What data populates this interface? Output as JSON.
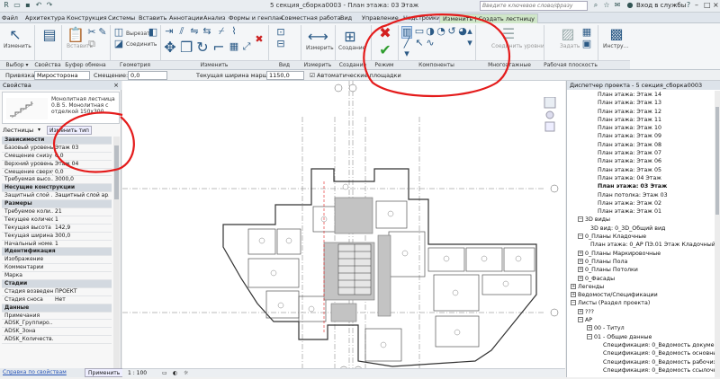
{
  "titlebar": {
    "title": "5 секция_сборка0003 - План этажа: 03 Этаж",
    "search_placeholder": "Введите ключевое слово/фразу",
    "login": "Вход в службы",
    "help": "?"
  },
  "tabs": [
    {
      "label": "Файл",
      "active": false
    },
    {
      "label": "Архитектура",
      "active": false
    },
    {
      "label": "Конструкция",
      "active": false
    },
    {
      "label": "Системы",
      "active": false
    },
    {
      "label": "Вставить",
      "active": false
    },
    {
      "label": "Аннотации",
      "active": false
    },
    {
      "label": "Анализ",
      "active": false
    },
    {
      "label": "Формы и генплан",
      "active": false
    },
    {
      "label": "Совместная работа",
      "active": false
    },
    {
      "label": "Вид",
      "active": false
    },
    {
      "label": "Управление",
      "active": false
    },
    {
      "label": "Надстройки",
      "active": false
    },
    {
      "label": "Изменить | Создать лестницу",
      "active": true
    }
  ],
  "ribbon": {
    "modify_label": "Изменить",
    "insert_label": "Вставить",
    "cut_label": "Вырезать",
    "join_label": "Соединить",
    "measure_label": "Измерить",
    "create_label": "Создание",
    "multilevel_label": "Соединить уровни",
    "set_label": "Задать",
    "tools_label": "Инстру...",
    "panels": [
      "Выбор ▾",
      "Свойства",
      "Буфер обмена",
      "Геометрия",
      "Изменить",
      "Вид",
      "Измерить",
      "Создание",
      "Режим",
      "Компоненты",
      "Многоэтажные лестницы",
      "Рабочая плоскость",
      ""
    ]
  },
  "options": {
    "binding_label": "Привязка:",
    "binding_value": "Миросторона",
    "offset_label": "Смещение:",
    "offset_value": "0,0",
    "width_label": "Текущая ширина марша:",
    "width_value": "1150,0",
    "auto_platform": "Автоматические площадки"
  },
  "properties": {
    "header": "Свойства",
    "type_name": "Монолитная лестница 0.В 5. Монолитная с отделкой 150х300",
    "selector_label": "Лестницы",
    "edit_type": "Изменить тип",
    "rows": [
      {
        "group": true,
        "key": "Зависимости"
      },
      {
        "key": "Базовый уровень",
        "value": "Этаж 03"
      },
      {
        "key": "Смещение снизу",
        "value": "0,0"
      },
      {
        "key": "Верхний уровень",
        "value": "Этаж 04"
      },
      {
        "key": "Смещение сверху",
        "value": "0,0"
      },
      {
        "key": "Требуемая высо...",
        "value": "3000,0"
      },
      {
        "group": true,
        "key": "Несущие конструкции"
      },
      {
        "key": "Защитный слой ...",
        "value": "Защитный слой ар..."
      },
      {
        "group": true,
        "key": "Размеры"
      },
      {
        "key": "Требуемое коли...",
        "value": "21"
      },
      {
        "key": "Текущее количес...",
        "value": "1"
      },
      {
        "key": "Текущая высота ...",
        "value": "142,9"
      },
      {
        "key": "Текущая ширина ...",
        "value": "300,0"
      },
      {
        "key": "Начальный номе...",
        "value": "1"
      },
      {
        "group": true,
        "key": "Идентификация"
      },
      {
        "key": "Изображение",
        "value": ""
      },
      {
        "key": "Комментарии",
        "value": ""
      },
      {
        "key": "Марка",
        "value": ""
      },
      {
        "group": true,
        "key": "Стадии"
      },
      {
        "key": "Стадия возведен...",
        "value": "ПРОЕКТ"
      },
      {
        "key": "Стадия сноса",
        "value": "Нет"
      },
      {
        "group": true,
        "key": "Данные"
      },
      {
        "key": "Примечания",
        "value": ""
      },
      {
        "key": "ADSK_Группиро...",
        "value": ""
      },
      {
        "key": "ADSK_Зона",
        "value": ""
      },
      {
        "key": "ADSK_Количеств...",
        "value": ""
      }
    ],
    "help_link": "Справка по свойствам",
    "apply": "Применить"
  },
  "browser": {
    "header": "Диспетчер проекта - 5 секция_сборка0003",
    "nodes": [
      {
        "indent": 34,
        "label": "План этажа: Этаж 14",
        "exp": "",
        "bold": false
      },
      {
        "indent": 34,
        "label": "План этажа: Этаж 13",
        "exp": "",
        "bold": false
      },
      {
        "indent": 34,
        "label": "План этажа: Этаж 12",
        "exp": "",
        "bold": false
      },
      {
        "indent": 34,
        "label": "План этажа: Этаж 11",
        "exp": "",
        "bold": false
      },
      {
        "indent": 34,
        "label": "План этажа: Этаж 10",
        "exp": "",
        "bold": false
      },
      {
        "indent": 34,
        "label": "План этажа: Этаж 09",
        "exp": "",
        "bold": false
      },
      {
        "indent": 34,
        "label": "План этажа: Этаж 08",
        "exp": "",
        "bold": false
      },
      {
        "indent": 34,
        "label": "План этажа: Этаж 07",
        "exp": "",
        "bold": false
      },
      {
        "indent": 34,
        "label": "План этажа: Этаж 06",
        "exp": "",
        "bold": false
      },
      {
        "indent": 34,
        "label": "План этажа: Этаж 05",
        "exp": "",
        "bold": false
      },
      {
        "indent": 34,
        "label": "План этажа: 04 Этаж",
        "exp": "",
        "bold": false
      },
      {
        "indent": 34,
        "label": "План этажа: 03 Этаж",
        "exp": "",
        "bold": true
      },
      {
        "indent": 34,
        "label": "План потолка: Этаж 03",
        "exp": "",
        "bold": false
      },
      {
        "indent": 34,
        "label": "План этажа: Этаж 02",
        "exp": "",
        "bold": false
      },
      {
        "indent": 34,
        "label": "План этажа: Этаж 01",
        "exp": "",
        "bold": false
      },
      {
        "indent": 12,
        "label": "3D виды",
        "exp": "−",
        "bold": false
      },
      {
        "indent": 26,
        "label": "3D вид: 0_3D_Общий вид",
        "exp": "",
        "bold": false
      },
      {
        "indent": 12,
        "label": "0_Планы Кладочные",
        "exp": "−",
        "bold": false
      },
      {
        "indent": 26,
        "label": "План этажа: 0_АР ПЭ.01 Этаж Кладочный",
        "exp": "",
        "bold": false
      },
      {
        "indent": 12,
        "label": "0_Планы Маркировочные",
        "exp": "+",
        "bold": false
      },
      {
        "indent": 12,
        "label": "0_Планы Пола",
        "exp": "+",
        "bold": false
      },
      {
        "indent": 12,
        "label": "0_Планы Потолки",
        "exp": "+",
        "bold": false
      },
      {
        "indent": 12,
        "label": "0_Фасады",
        "exp": "+",
        "bold": false
      },
      {
        "indent": 4,
        "label": "Легенды",
        "exp": "+",
        "bold": false
      },
      {
        "indent": 4,
        "label": "Ведомости/Спецификации",
        "exp": "+",
        "bold": false
      },
      {
        "indent": 4,
        "label": "Листы (Раздел проекта)",
        "exp": "−",
        "bold": false
      },
      {
        "indent": 12,
        "label": "???",
        "exp": "+",
        "bold": false
      },
      {
        "indent": 12,
        "label": "АР",
        "exp": "−",
        "bold": false
      },
      {
        "indent": 22,
        "label": "00 - Титул",
        "exp": "+",
        "bold": false
      },
      {
        "indent": 22,
        "label": "01 - Общие данные",
        "exp": "−",
        "bold": false
      },
      {
        "indent": 40,
        "label": "Спецификация: 0_Ведомость документ...",
        "exp": "",
        "bold": false
      },
      {
        "indent": 40,
        "label": "Спецификация: 0_Ведомость основны...",
        "exp": "",
        "bold": false
      },
      {
        "indent": 40,
        "label": "Спецификация: 0_Ведомость рабочих...",
        "exp": "",
        "bold": false
      },
      {
        "indent": 40,
        "label": "Спецификация: 0_Ведомость ссылочн...",
        "exp": "",
        "bold": false
      }
    ]
  },
  "status": {
    "scale": "1 : 100"
  },
  "colors": {
    "annotation_red": "#e41b1b",
    "finish_green": "#2e9d2e",
    "cancel_red": "#d32020",
    "ribbon_blue": "#2b5a86"
  }
}
